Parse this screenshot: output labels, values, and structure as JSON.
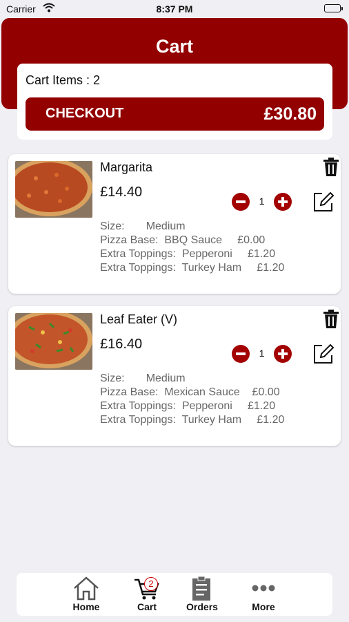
{
  "status_bar": {
    "carrier": "Carrier",
    "time": "8:37 PM"
  },
  "header": {
    "title": "Cart"
  },
  "summary": {
    "items_label": "Cart Items : 2",
    "checkout_label": "CHECKOUT",
    "total": "£30.80"
  },
  "items": [
    {
      "name": "Margarita",
      "price": "£14.40",
      "quantity": "1",
      "details": [
        "Size:       Medium",
        "Pizza Base:  BBQ Sauce     £0.00",
        "Extra Toppings:  Pepperoni     £1.20",
        "Extra Toppings:  Turkey Ham     £1.20"
      ]
    },
    {
      "name": "Leaf Eater (V)",
      "price": "£16.40",
      "quantity": "1",
      "details": [
        "Size:       Medium",
        "Pizza Base:  Mexican Sauce    £0.00",
        "Extra Toppings:  Pepperoni     £1.20",
        "Extra Toppings:  Turkey Ham     £1.20"
      ]
    }
  ],
  "tab_bar": {
    "home": "Home",
    "cart": "Cart",
    "cart_badge": "2",
    "orders": "Orders",
    "more": "More"
  },
  "colors": {
    "brand": "#930000",
    "background": "#efeff4"
  },
  "icons": [
    "wifi-icon",
    "battery-icon",
    "trash-icon",
    "edit-icon",
    "minus-circle-icon",
    "plus-circle-icon",
    "home-icon",
    "cart-icon",
    "orders-icon",
    "more-icon"
  ]
}
